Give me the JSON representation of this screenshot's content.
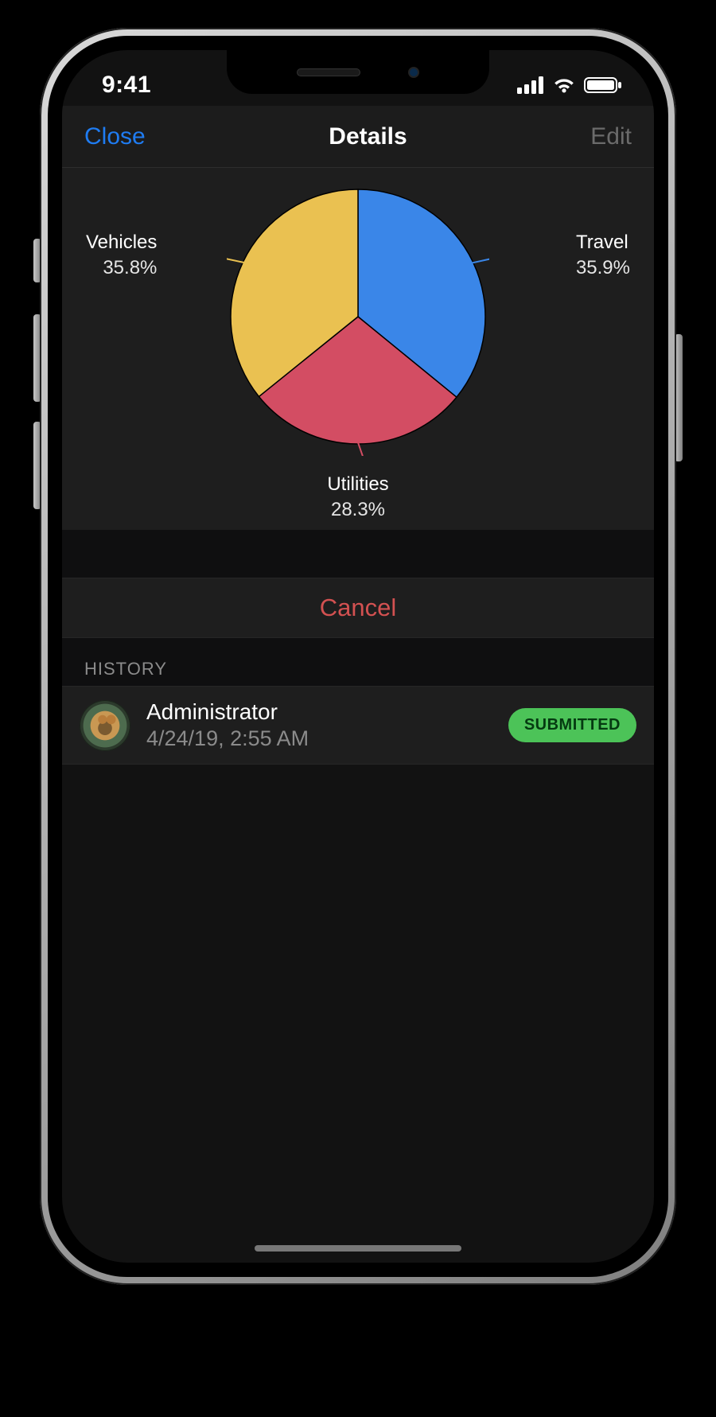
{
  "status": {
    "time": "9:41"
  },
  "nav": {
    "close": "Close",
    "title": "Details",
    "edit": "Edit"
  },
  "chart_data": {
    "type": "pie",
    "title": "",
    "series": [
      {
        "name": "Travel",
        "value": 35.9,
        "label": "35.9%",
        "color": "#3a86e8"
      },
      {
        "name": "Utilities",
        "value": 28.3,
        "label": "28.3%",
        "color": "#d34d63"
      },
      {
        "name": "Vehicles",
        "value": 35.8,
        "label": "35.8%",
        "color": "#eac151"
      }
    ]
  },
  "actions": {
    "cancel": "Cancel"
  },
  "history": {
    "header": "HISTORY",
    "items": [
      {
        "name": "Administrator",
        "time": "4/24/19, 2:55 AM",
        "status": "SUBMITTED"
      }
    ]
  }
}
